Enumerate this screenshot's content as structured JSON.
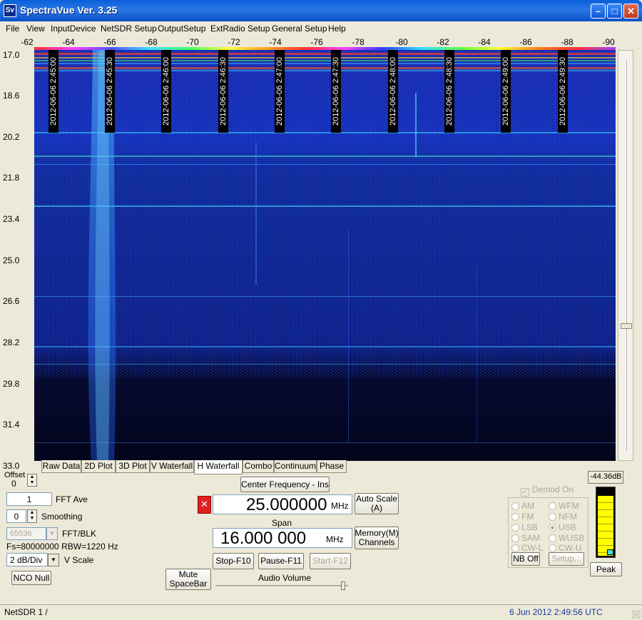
{
  "window": {
    "title": "SpectraVue Ver. 3.25",
    "icon": "Sv"
  },
  "menu": [
    "File",
    "View",
    "InputDevice",
    "NetSDR Setup",
    "OutputSetup",
    "ExtRadio Setup",
    "General Setup",
    "Help"
  ],
  "x_axis_ticks": [
    "-62",
    "-64",
    "-66",
    "-68",
    "-70",
    "-72",
    "-74",
    "-76",
    "-78",
    "-80",
    "-82",
    "-84",
    "-86",
    "-88",
    "-90"
  ],
  "y_axis_ticks": [
    "17.0",
    "18.6",
    "20.2",
    "21.8",
    "23.4",
    "25.0",
    "26.6",
    "28.2",
    "29.8",
    "31.4",
    "33.0"
  ],
  "timestamps": [
    "2012-06-06 2:45:00",
    "2012-06-06 2:45:30",
    "2012-06-06 2:46:00",
    "2012-06-06 2:46:30",
    "2012-06-06 2:47:00",
    "2012-06-06 2:47:30",
    "2012-06-06 2:48:00",
    "2012-06-06 2:48:30",
    "2012-06-06 2:49:00",
    "2012-06-06 2:49:30"
  ],
  "tabs": [
    "Raw Data",
    "2D Plot",
    "3D Plot",
    "V Waterfall",
    "H Waterfall",
    "Combo",
    "Continuum",
    "Phase"
  ],
  "active_tab": "H Waterfall",
  "controls": {
    "offset_label": "Offset",
    "offset_value": "0",
    "fft_ave_value": "1",
    "fft_ave_label": "FFT Ave",
    "smoothing_value": "0",
    "smoothing_label": "Smoothing",
    "fft_blk_value": "65536",
    "fft_blk_label": "FFT/BLK",
    "fs_info": "Fs=80000000 RBW=1220 Hz",
    "vscale_value": "2 dB/Div",
    "vscale_label": "V Scale",
    "nco_null": "NCO Null",
    "mute": "Mute\nSpaceBar",
    "center_freq_label": "Center Frequency - Ins",
    "center_freq_value": "25.000000",
    "center_freq_unit": "MHz",
    "auto_scale": "Auto Scale\n(A)",
    "span_label": "Span",
    "span_value": "16.000 000",
    "span_unit": "MHz",
    "memory": "Memory(M)\nChannels",
    "stop": "Stop-F10",
    "pause": "Pause-F11",
    "start": "Start-F12",
    "audio_volume_label": "Audio Volume",
    "audio_volume_level": 0.95
  },
  "demod": {
    "demod_on_label": "Demod On",
    "modes": [
      "AM",
      "WFM",
      "FM",
      "NFM",
      "LSB",
      "USB",
      "SAM",
      "WUSB",
      "CW-L",
      "CW-U"
    ],
    "selected": "USB",
    "nb_off": "NB Off",
    "setup": "Setup..."
  },
  "meter": {
    "reading": "-44.36dB",
    "peak_label": "Peak",
    "level": 0.88
  },
  "status": {
    "device": "NetSDR 1  /",
    "datetime": "6 Jun 2012  2:49:56 UTC"
  },
  "colors": {
    "waterfall_bg": "#06082a",
    "meter_fill": "#ffff00"
  }
}
